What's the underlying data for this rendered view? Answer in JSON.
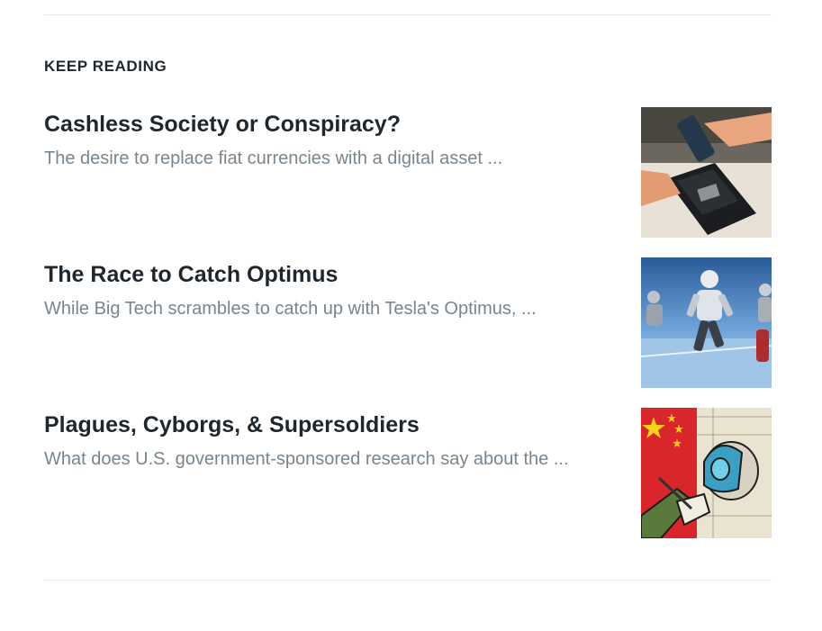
{
  "section": {
    "title": "KEEP READING"
  },
  "articles": [
    {
      "title": "Cashless Society or Conspiracy?",
      "excerpt": "The desire to replace fiat currencies with a digital asset ...",
      "thumbnail": "payment-terminal-image"
    },
    {
      "title": "The Race to Catch Optimus",
      "excerpt": "While Big Tech scrambles to catch up with Tesla's Optimus, ...",
      "thumbnail": "running-robots-image"
    },
    {
      "title": "Plagues, Cyborgs, & Supersoldiers",
      "excerpt": "What does U.S. government-sponsored research say about the ...",
      "thumbnail": "cyborg-soldier-art-image"
    }
  ],
  "colors": {
    "title": "#1e262e",
    "excerpt": "#77858f",
    "divider": "#e1e8ee"
  }
}
